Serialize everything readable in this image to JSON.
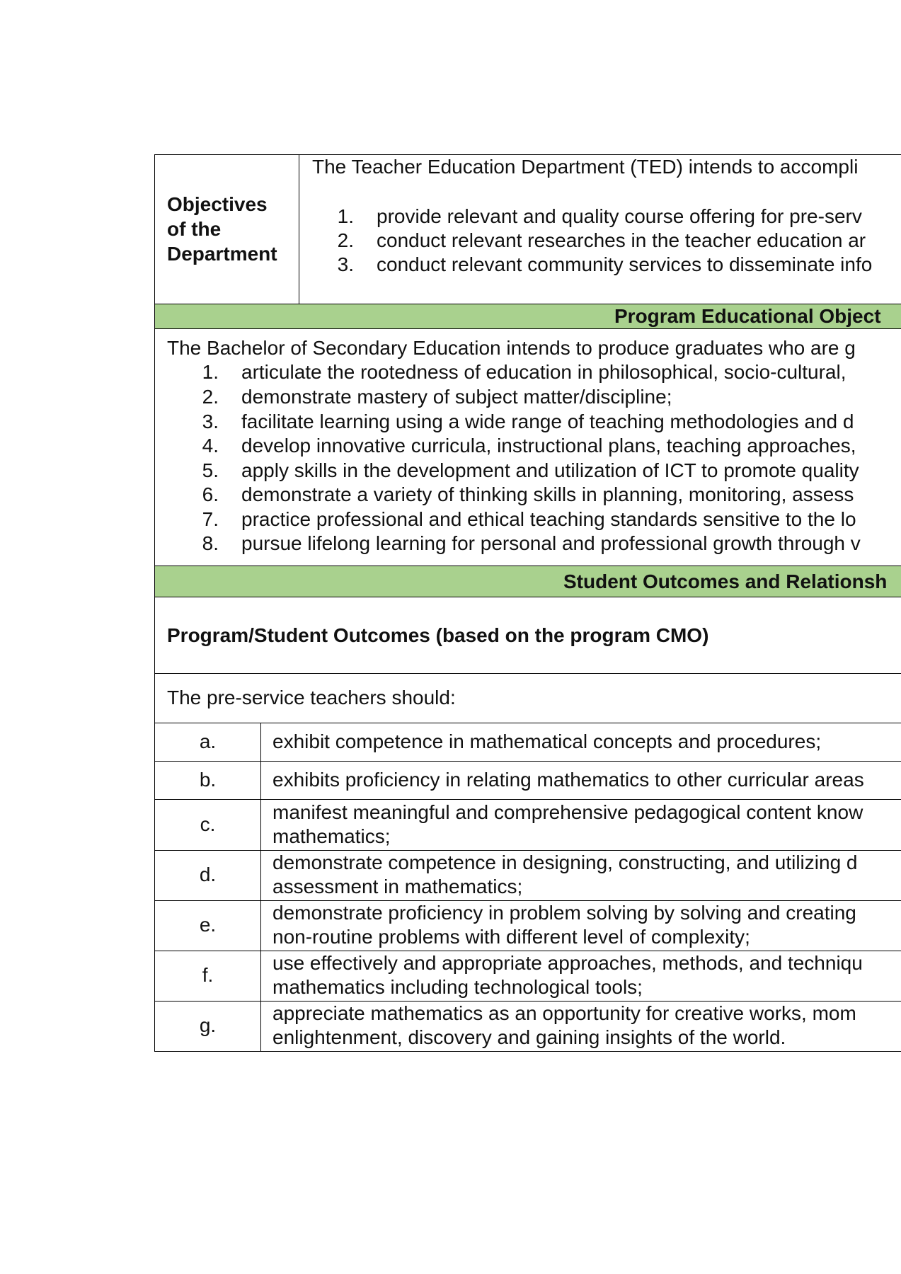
{
  "department_objectives": {
    "label": "Objectives\nof the\nDepartment",
    "intro": "The Teacher Education Department (TED) intends to accompli",
    "items": [
      {
        "num": "1.",
        "text": "provide relevant and quality course offering for pre-serv"
      },
      {
        "num": "2.",
        "text": "conduct relevant researches in the teacher education ar"
      },
      {
        "num": "3.",
        "text": "conduct relevant community services to disseminate info"
      }
    ]
  },
  "peo": {
    "header": "Program Educational Object",
    "intro": "The Bachelor of Secondary Education intends to produce graduates who are g",
    "items": [
      {
        "num": "1.",
        "text": "articulate the rootedness of education in philosophical, socio-cultural,"
      },
      {
        "num": "2.",
        "text": "demonstrate mastery of subject matter/discipline;"
      },
      {
        "num": "3.",
        "text": "facilitate learning using a wide range of teaching methodologies and d"
      },
      {
        "num": "4.",
        "text": "develop innovative curricula, instructional plans, teaching approaches,"
      },
      {
        "num": "5.",
        "text": "apply skills in the development and utilization of ICT to promote quality"
      },
      {
        "num": "6.",
        "text": "demonstrate a variety of thinking skills in planning, monitoring, assess"
      },
      {
        "num": "7.",
        "text": "practice professional and ethical teaching standards sensitive to the lo"
      },
      {
        "num": "8.",
        "text": "pursue lifelong learning for personal and professional growth through v"
      }
    ]
  },
  "student_outcomes": {
    "header": "Student Outcomes and Relationsh",
    "subheader": "Program/Student Outcomes (based on the program CMO)",
    "intro": "The pre-service teachers should:",
    "items": [
      {
        "letter": "a.",
        "line1": "exhibit competence in mathematical concepts and procedures;",
        "line2": ""
      },
      {
        "letter": "b.",
        "line1": "exhibits proficiency in relating mathematics to other curricular areas",
        "line2": ""
      },
      {
        "letter": "c.",
        "line1": "manifest meaningful and comprehensive pedagogical content know",
        "line2": "mathematics;"
      },
      {
        "letter": "d.",
        "line1": "demonstrate competence in designing, constructing, and utilizing d",
        "line2": "assessment in mathematics;"
      },
      {
        "letter": "e.",
        "line1": "demonstrate proficiency in problem solving by solving and creating",
        "line2": "non-routine problems with different level of complexity;"
      },
      {
        "letter": "f.",
        "line1": "use effectively and appropriate approaches, methods, and techniqu",
        "line2": "mathematics including technological tools;"
      },
      {
        "letter": "g.",
        "line1": "appreciate mathematics as an opportunity for creative works, mom",
        "line2": "enlightenment, discovery and gaining insights of the world."
      }
    ]
  },
  "colors": {
    "header_green": "#a9d18e",
    "border": "#000000",
    "text": "#111111"
  }
}
